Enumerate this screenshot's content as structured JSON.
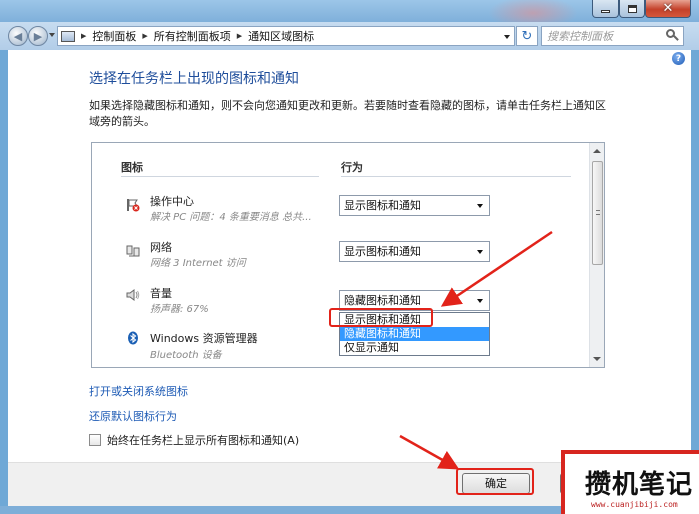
{
  "address_bar": {
    "breadcrumbs": [
      "控制面板",
      "所有控制面板项",
      "通知区域图标"
    ],
    "search_placeholder": "搜索控制面板"
  },
  "page": {
    "title": "选择在任务栏上出现的图标和通知",
    "description": "如果选择隐藏图标和通知，则不会向您通知更改和更新。若要随时查看隐藏的图标，请单击任务栏上通知区域旁的箭头。"
  },
  "table": {
    "headers": {
      "icon": "图标",
      "behavior": "行为"
    },
    "rows": [
      {
        "name": "操作中心",
        "subtitle": "解决 PC 问题：4 条重要消息 总共...",
        "behavior": "显示图标和通知",
        "icon": "action-center-flag-icon"
      },
      {
        "name": "网络",
        "subtitle": "网络 3 Internet 访问",
        "behavior": "显示图标和通知",
        "icon": "network-icon"
      },
      {
        "name": "音量",
        "subtitle": "扬声器: 67%",
        "behavior": "隐藏图标和通知",
        "icon": "speaker-icon"
      },
      {
        "name": "Windows 资源管理器",
        "subtitle": "Bluetooth 设备",
        "behavior": "",
        "icon": "bluetooth-icon"
      }
    ],
    "dropdown_options": [
      "显示图标和通知",
      "隐藏图标和通知",
      "仅显示通知"
    ],
    "dropdown_selected_index": 1
  },
  "links": {
    "system_icons": "打开或关闭系统图标",
    "restore_defaults": "还原默认图标行为"
  },
  "checkbox": {
    "label": "始终在任务栏上显示所有图标和通知(A)",
    "checked": false
  },
  "buttons": {
    "ok": "确定"
  },
  "watermark": {
    "title": "攒机笔记",
    "url": "www.cuanjibiji.com"
  },
  "colors": {
    "title_blue": "#1e4d9b",
    "link_blue": "#1e5bb5",
    "highlight": "#3399ff",
    "annotation_red": "#e2231a"
  }
}
